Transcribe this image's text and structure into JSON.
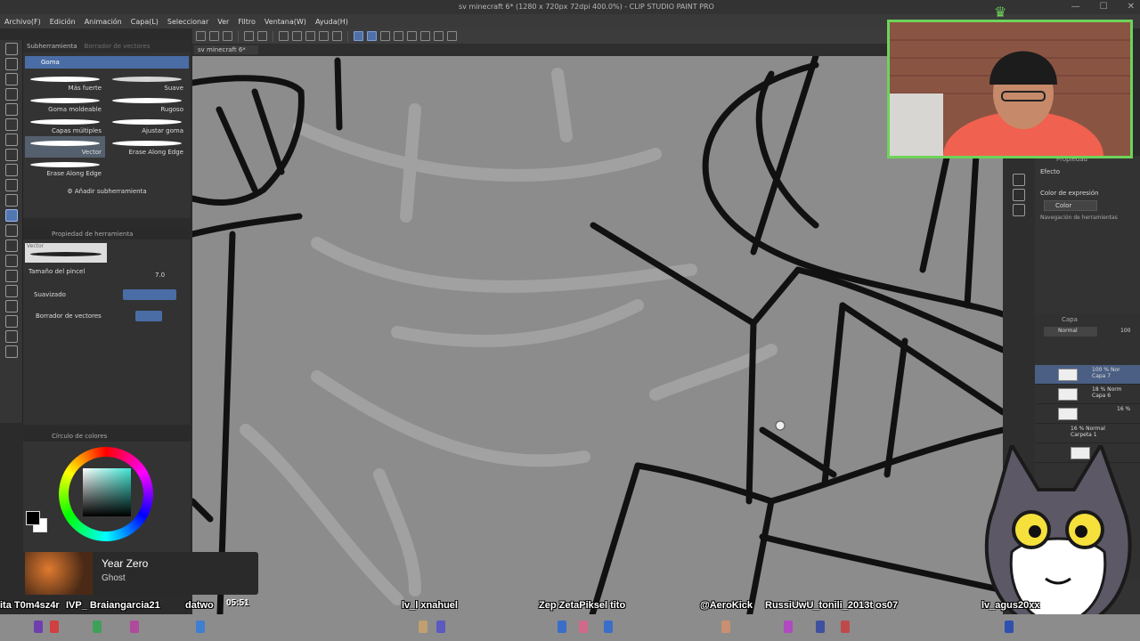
{
  "window": {
    "title": "sv minecraft 6* (1280 x 720px 72dpi 400.0%) - CLIP STUDIO PAINT PRO",
    "controls": [
      "—",
      "☐",
      "✕"
    ]
  },
  "menu": [
    "Archivo(F)",
    "Edición",
    "Animación",
    "Capa(L)",
    "Seleccionar",
    "Ver",
    "Filtro",
    "Ventana(W)",
    "Ayuda(H)"
  ],
  "document_tab": "sv minecraft 6*",
  "subtool_panel": {
    "tabs": [
      "Subherramienta",
      "Borrador de vectores"
    ],
    "group": "Goma",
    "brushes": [
      "Más fuerte",
      "Suave",
      "Goma moldeable",
      "Rugoso",
      "Capas múltiples",
      "Ajustar goma",
      "Vector",
      "Erase Along Edge",
      "Erase Along Edge"
    ],
    "selected_brush": "Vector",
    "add_label": "Añadir subherramienta"
  },
  "tool_property": {
    "title": "Propiedad de herramienta",
    "preset": "Vector",
    "brush_size_label": "Tamaño del pincel",
    "brush_size_value": "7.0",
    "smoothing_label": "Suavizado",
    "vector_eraser_label": "Borrador de vectores"
  },
  "color_panel": {
    "title": "Círculo de colores",
    "fg": "#000000",
    "bg": "#ffffff",
    "hue_color": "#3fe6d4"
  },
  "right_panel": {
    "tab": "Propiedad",
    "effect_label": "Efecto",
    "expression_label": "Color de expresión",
    "expression_value": "Color",
    "nav_label": "Navegación de herramientas"
  },
  "layers": {
    "tab": "Capa",
    "blend_mode": "Normal",
    "opacity": "100",
    "rows": [
      {
        "opacity": "100 % Nor",
        "name": "Capa 7",
        "selected": true
      },
      {
        "opacity": "18 % Norm",
        "name": "Capa 6",
        "selected": false
      },
      {
        "opacity": "16 %",
        "name": "",
        "selected": false
      },
      {
        "opacity": "16 % Normal",
        "name": "Carpeta 1",
        "selected": false
      },
      {
        "opacity": "",
        "name": "",
        "selected": false
      }
    ]
  },
  "music": {
    "title": "Year Zero",
    "artist": "Ghost"
  },
  "stream": {
    "timer": "05:51",
    "chat_names": [
      "ita T0m4sz4r",
      "IVP_ Braiangarcia21",
      "datwo",
      "lv_l xnahuel",
      "Zep ZetaPiksel tito",
      "@AeroKick",
      "RussiUwU_tonili_2013t os07",
      "lv_agus20xx"
    ]
  },
  "colors": {
    "accent": "#4a6da6",
    "cam_border": "#6ed35a",
    "canvas_bg": "#8c8c8c"
  }
}
